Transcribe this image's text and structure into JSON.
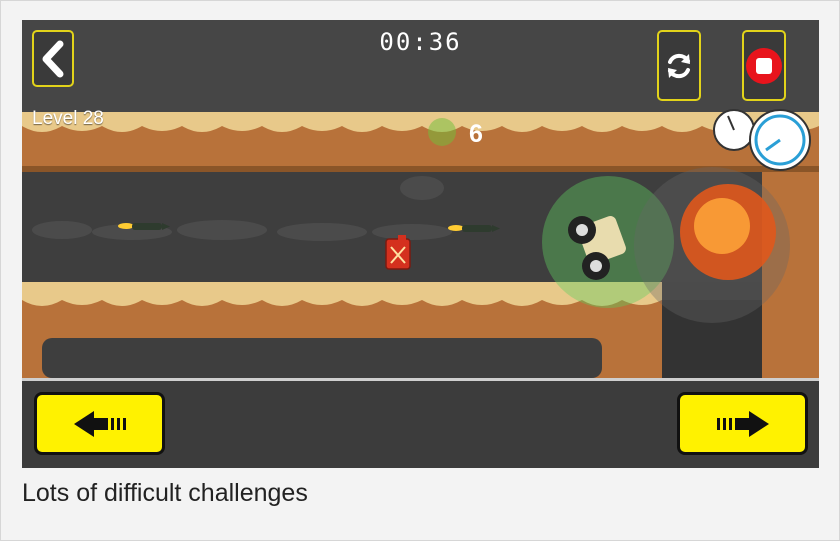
{
  "hud": {
    "timer": "00:36",
    "level_label": "Level 28",
    "coin_count": "6"
  },
  "controls": {
    "back_icon": "chevron-left-icon",
    "restart_icon": "refresh-icon",
    "stop_icon": "stop-icon",
    "left_icon": "arrow-left-icon",
    "right_icon": "arrow-right-icon"
  },
  "colors": {
    "accent_yellow": "#fff200",
    "button_border": "#e2d31a",
    "stop_red": "#e8141c",
    "sand": "#e8c98a",
    "dirt": "#b8723a"
  },
  "caption": "Lots of difficult challenges"
}
